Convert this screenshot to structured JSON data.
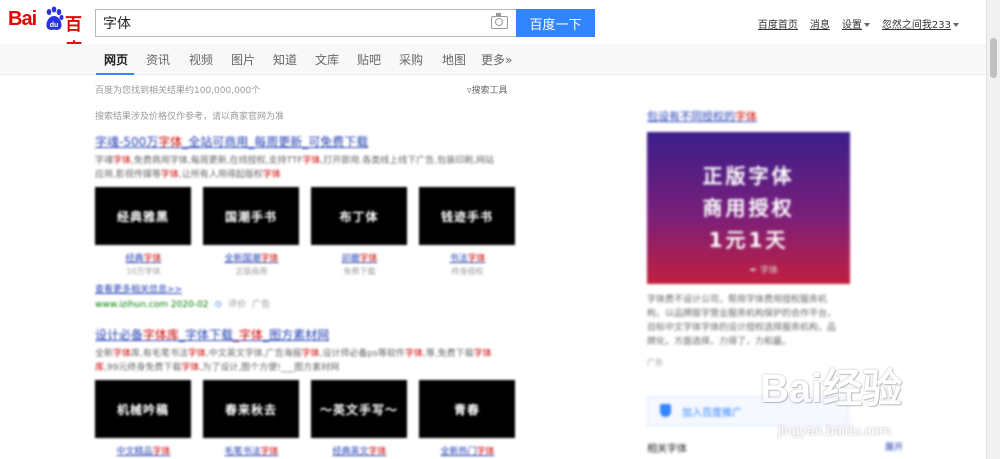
{
  "header": {
    "logo_prefix": "Bai",
    "logo_suffix": "百度",
    "search_value": "字体",
    "search_button": "百度一下",
    "links": [
      "百度首页",
      "消息",
      "设置",
      "忽然之间我233"
    ]
  },
  "tabs": [
    "网页",
    "资讯",
    "视频",
    "图片",
    "知道",
    "文库",
    "贴吧",
    "采购",
    "地图",
    "更多»"
  ],
  "results_meta": "百度为您找到相关结果约100,000,000个",
  "search_tools": "搜索工具",
  "notice": "搜索结果涉及价格仅作参考，请以商家官网为准",
  "results": [
    {
      "title_parts": [
        "字魂-500万",
        "字体",
        "_全站可商用_每周更新_可免费下载"
      ],
      "desc_parts": [
        "字魂",
        "字体",
        ",免费商用字体,每周更新,在线授权,支持TTF",
        "字体",
        ",打开即用.各类线上线下广告,包装印刷,网站应用,影视传媒等",
        "字体",
        ",让所有人用得起版权",
        "字体"
      ],
      "thumbs": [
        {
          "img": "经典雅黑",
          "label_prefix": "经典",
          "label_em": "字体",
          "sub": "10万字体"
        },
        {
          "img": "国潮手书",
          "label_prefix": "全新国潮",
          "label_em": "字体",
          "sub": "正版商用"
        },
        {
          "img": "布丁体",
          "label_prefix": "卯磨",
          "label_em": "字体",
          "sub": "免费下载"
        },
        {
          "img": "钱迹手书",
          "label_prefix": "书法",
          "label_em": "字体",
          "sub": "终身授权"
        }
      ],
      "more": "查看更多相关信息>>",
      "url": "www.izihun.com",
      "date": "2020-02",
      "review": "评价",
      "ad_label": "广告"
    },
    {
      "title_parts": [
        "设计必备",
        "字体库",
        "_字体下载",
        "_字体",
        "_图方素材网"
      ],
      "desc_parts": [
        "全新",
        "字体",
        "库,有毛笔书法",
        "字体",
        ",中文英文字体,广告海报",
        "字体",
        ",设计师必备ps等软件",
        "字体",
        ",等,免费下载",
        "字体库",
        ",99元终身免费下载",
        "字体",
        ",为了设计,图个方便!___图方素材网"
      ],
      "thumbs": [
        {
          "img": "机械吟稿",
          "label_prefix": "中文精品",
          "label_em": "字体",
          "sub": ""
        },
        {
          "img": "春来秋去",
          "label_prefix": "毛笔书法",
          "label_em": "字体",
          "sub": ""
        },
        {
          "img": "～英文手写～",
          "label_prefix": "经典英文",
          "label_em": "字体",
          "sub": ""
        },
        {
          "img": "青春",
          "label_prefix": "全新热门",
          "label_em": "字体",
          "sub": ""
        }
      ]
    }
  ],
  "ad": {
    "title_prefix": "包设有不同授权的",
    "title_em": "字体",
    "banner_lines": [
      "正版字体",
      "商用授权",
      "1元1天"
    ],
    "banner_small": "✒ 字体",
    "desc": "字体费不设计公司，帮用字体费用授权服务机构，以品牌版字营业服务机构保护的合作平台，目标中文字体字体的设计授权选择服务机构，品牌化，方面选择，力得了，力和最。",
    "tag": "广告"
  },
  "side_button": "加入百度推广",
  "related": "相关字体",
  "related_more": "展开",
  "watermark": {
    "text": "Bai经验",
    "url": "jingyan.baidu.com"
  }
}
